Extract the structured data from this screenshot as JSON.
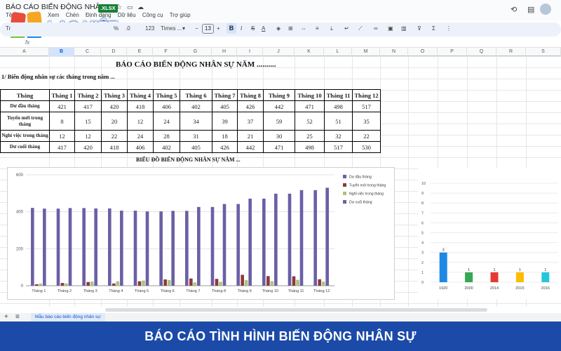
{
  "app": {
    "doc_title": "BÁO CÁO BIẾN ĐỘNG NHÂN SỰ",
    "file_badge": ".XLSX",
    "menu_first": "Tệ",
    "menu": [
      "Xem",
      "Chèn",
      "Định dạng",
      "Dữ liệu",
      "Công cụ",
      "Trợ giúp"
    ]
  },
  "brand": {
    "logo_text": "LẠC VIỆT",
    "colors": [
      "#e84c3d",
      "#f5a623",
      "#7ac143",
      "#1e88e5",
      "#1b4aa8"
    ]
  },
  "toolbar": {
    "left_label": "Tr",
    "percent": "%",
    "dec": ".0",
    "format123": "123",
    "font_name": "Times ...",
    "font_size": "13",
    "bold": "B",
    "italic": "I",
    "strike": "S",
    "text_color": "A",
    "minus": "−",
    "plus": "+"
  },
  "formula_bar": {
    "fx": "fx"
  },
  "columns": [
    "A",
    "B",
    "C",
    "D",
    "E",
    "F",
    "G",
    "H",
    "I",
    "J",
    "K",
    "L",
    "M",
    "N",
    "O",
    "P",
    "Q",
    "R",
    "S"
  ],
  "selected_column": "B",
  "report": {
    "title": "BÁO CÁO BIẾN ĐỘNG NHÂN SỰ NĂM ..........",
    "section": "1/ Biến động nhân sự các tháng trong năm ...",
    "chart_heading": "BIỂU ĐỒ BIẾN ĐỘNG NHÂN SỰ NĂM ..."
  },
  "table": {
    "header_label": "Tháng",
    "months": [
      "Tháng 1",
      "Tháng 2",
      "Tháng 3",
      "Tháng 4",
      "Tháng 5",
      "Tháng 6",
      "Tháng 7",
      "Tháng 8",
      "Tháng 9",
      "Tháng 10",
      "Tháng 11",
      "Tháng 12"
    ],
    "rows": [
      {
        "label": "Dư đầu tháng",
        "values": [
          "421",
          "417",
          "420",
          "418",
          "406",
          "402",
          "405",
          "426",
          "442",
          "471",
          "498",
          "517"
        ]
      },
      {
        "label": "Tuyển mới trong tháng",
        "values": [
          "8",
          "15",
          "20",
          "12",
          "24",
          "34",
          "39",
          "37",
          "59",
          "52",
          "51",
          "35"
        ]
      },
      {
        "label": "Nghỉ việc trong tháng",
        "values": [
          "12",
          "12",
          "22",
          "24",
          "28",
          "31",
          "18",
          "21",
          "30",
          "25",
          "32",
          "22"
        ]
      },
      {
        "label": "Dư cuối tháng",
        "values": [
          "417",
          "420",
          "418",
          "406",
          "402",
          "405",
          "426",
          "442",
          "471",
          "498",
          "517",
          "530"
        ]
      }
    ]
  },
  "chart_data": [
    {
      "type": "bar",
      "categories": [
        "Tháng 1",
        "Tháng 2",
        "Tháng 3",
        "Tháng 4",
        "Tháng 5",
        "Tháng 6",
        "Tháng 7",
        "Tháng 8",
        "Tháng 9",
        "Tháng 10",
        "Tháng 11",
        "Tháng 12"
      ],
      "series": [
        {
          "name": "Dư đầu tháng",
          "color": "#6b5fa5",
          "values": [
            421,
            417,
            420,
            418,
            406,
            402,
            405,
            426,
            442,
            471,
            498,
            517
          ]
        },
        {
          "name": "Tuyển mới trong tháng",
          "color": "#8b3a3a",
          "values": [
            8,
            15,
            20,
            12,
            24,
            34,
            39,
            37,
            59,
            52,
            51,
            35
          ]
        },
        {
          "name": "Nghỉ việc trong tháng",
          "color": "#a9c47f",
          "values": [
            12,
            12,
            22,
            24,
            28,
            31,
            18,
            21,
            30,
            25,
            32,
            22
          ]
        },
        {
          "name": "Dư cuối tháng",
          "color": "#6b5fa5",
          "values": [
            417,
            420,
            418,
            406,
            402,
            405,
            426,
            442,
            471,
            498,
            517,
            530
          ]
        }
      ],
      "title": "",
      "xlabel": "",
      "ylabel": "",
      "ylim": [
        0,
        600
      ],
      "yticks": [
        0,
        200,
        400,
        600
      ],
      "grid": true,
      "legend": "right"
    },
    {
      "type": "bar",
      "categories": [
        "1920",
        "2000",
        "2014",
        "2015",
        "2016"
      ],
      "values": [
        3,
        1,
        1,
        1,
        1
      ],
      "colors": [
        "#1e88e5",
        "#34a853",
        "#e53935",
        "#fbbc04",
        "#26c6da"
      ],
      "title": "",
      "xlabel": "",
      "ylabel": "",
      "ylim": [
        0,
        10
      ],
      "yticks": [
        0,
        1,
        2,
        3,
        4,
        5,
        6,
        7,
        8,
        9,
        10
      ],
      "grid": true,
      "legend": "none"
    }
  ],
  "sheet_tabs": {
    "add": "+",
    "all": "≡",
    "active": "Mẫu báo cáo biến động nhân sự"
  },
  "banner": {
    "text": "BÁO CÁO TÌNH HÌNH BIẾN ĐỘNG NHÂN SỰ"
  }
}
